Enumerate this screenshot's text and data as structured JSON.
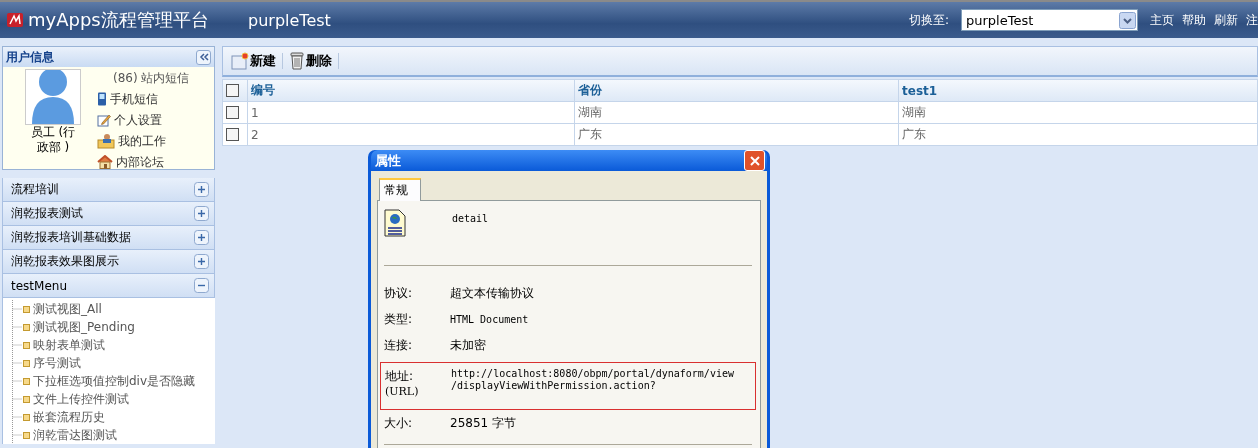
{
  "header": {
    "logo_text": "myApps流程管理平台",
    "app_name": "purpleTest",
    "switch_label": "切换至:",
    "switch_value": "purpleTest",
    "links": [
      "主页",
      "帮助",
      "刷新",
      "注"
    ]
  },
  "user_panel": {
    "title": "用户信息",
    "user_name": "员工 (行政部 )",
    "links": [
      {
        "kind": "plain",
        "label": "(86) 站内短信"
      },
      {
        "kind": "phone",
        "label": "手机短信"
      },
      {
        "kind": "edit",
        "label": "个人设置"
      },
      {
        "kind": "work",
        "label": "我的工作"
      },
      {
        "kind": "home",
        "label": "内部论坛"
      }
    ]
  },
  "menu_sections": [
    {
      "label": "流程培训",
      "expanded": false
    },
    {
      "label": "润乾报表测试",
      "expanded": false
    },
    {
      "label": "润乾报表培训基础数据",
      "expanded": false
    },
    {
      "label": "润乾报表效果图展示",
      "expanded": false
    },
    {
      "label": "testMenu",
      "expanded": true,
      "children": [
        "测试视图_All",
        "测试视图_Pending",
        "映射表单测试",
        "序号测试",
        "下拉框选项值控制div是否隐藏",
        "文件上传控件测试",
        "嵌套流程历史",
        "润乾雷达图测试"
      ]
    }
  ],
  "toolbar": [
    {
      "kind": "new",
      "label": "新建"
    },
    {
      "kind": "delete",
      "label": "删除"
    }
  ],
  "table": {
    "header_checked": false,
    "columns": [
      "编号",
      "省份",
      "test1"
    ],
    "rows": [
      {
        "checked": false,
        "cells": [
          "1",
          "湖南",
          "湖南"
        ]
      },
      {
        "checked": false,
        "cells": [
          "2",
          "广东",
          "广东"
        ]
      }
    ]
  },
  "dialog": {
    "title": "属性",
    "tabs": [
      {
        "label": "常规",
        "selected": true
      }
    ],
    "name": "detail",
    "fields": [
      {
        "label": "协议:",
        "value": "超文本传输协议",
        "mono": false
      },
      {
        "label": "类型:",
        "value": "HTML Document",
        "mono": true
      },
      {
        "label": "连接:",
        "value": "未加密",
        "mono": false
      }
    ],
    "address": {
      "label": "地址:",
      "sublabel": "(URL)",
      "highlighted": true,
      "lines": [
        "http://localhost:8080/obpm/portal/dynaform/view",
        "/displayViewWithPermission.action?"
      ]
    },
    "size": {
      "label": "大小:",
      "value": "25851 字节"
    }
  }
}
